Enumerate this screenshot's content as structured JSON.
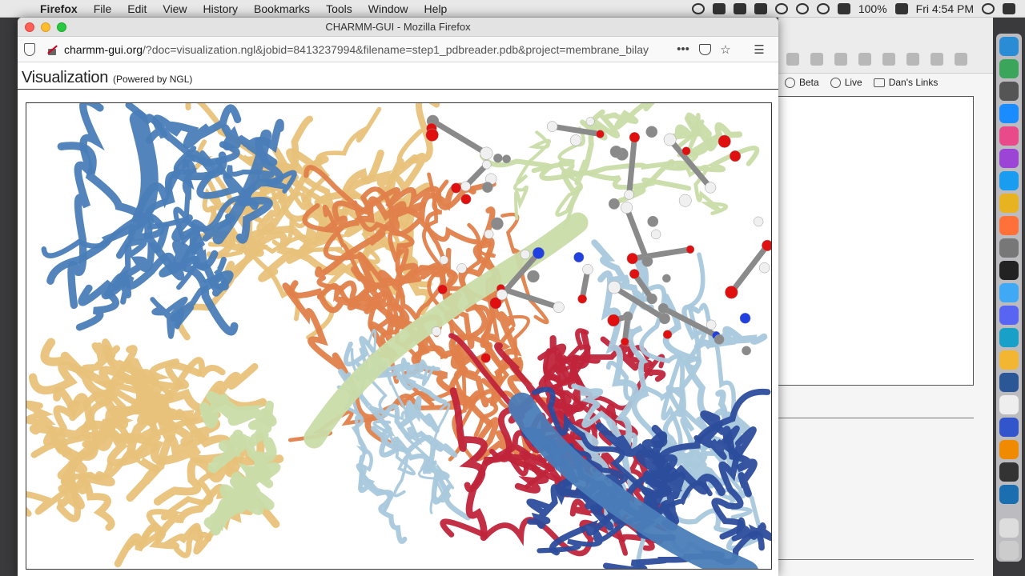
{
  "menubar": {
    "app_name": "Firefox",
    "items": [
      "File",
      "Edit",
      "View",
      "History",
      "Bookmarks",
      "Tools",
      "Window",
      "Help"
    ],
    "battery": "100%",
    "clock": "Fri 4:54 PM"
  },
  "window": {
    "title": "CHARMM-GUI - Mozilla Firefox"
  },
  "navbar": {
    "url_domain": "charmm-gui.org",
    "url_path": "/?doc=visualization.ngl&jobid=8413237994&filename=step1_pdbreader.pdb&project=membrane_bilay",
    "more_label": "•••"
  },
  "page": {
    "heading": "Visualization",
    "subheading": "(Powered by NGL)"
  },
  "background_window": {
    "bookmarks": [
      "Beta",
      "Live",
      "Dan's Links"
    ]
  },
  "colors": {
    "ribbon_blue": "#4a7db8",
    "ribbon_lightblue": "#a9c8dc",
    "ribbon_tan": "#e8c27a",
    "ribbon_orange": "#e0804a",
    "ribbon_red": "#c0243a",
    "ribbon_green": "#c9dca8",
    "ribbon_darkblue": "#2c4c9c",
    "atom_carbon": "#8a8a8a",
    "atom_oxygen": "#e01010",
    "atom_nitrogen": "#2040e0",
    "atom_hydrogen": "#f0f0f0"
  }
}
